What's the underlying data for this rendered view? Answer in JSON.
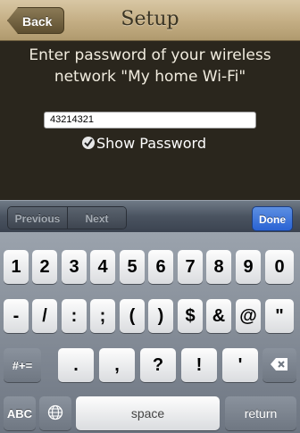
{
  "nav": {
    "back_label": "Back",
    "title": "Setup"
  },
  "prompt": {
    "line1": "Enter password of your wireless",
    "line2": "network \"My home Wi-Fi\""
  },
  "password_field": {
    "value": "43214321"
  },
  "show_password": {
    "label": "Show Password",
    "checked": true
  },
  "toolbar": {
    "previous": "Previous",
    "next": "Next",
    "done": "Done"
  },
  "keyboard": {
    "row1": [
      "1",
      "2",
      "3",
      "4",
      "5",
      "6",
      "7",
      "8",
      "9",
      "0"
    ],
    "row2": [
      "-",
      "/",
      ":",
      ";",
      "(",
      ")",
      "$",
      "&",
      "@",
      "\""
    ],
    "row3": {
      "mode": "#+=",
      "keys": [
        ".",
        ",",
        "?",
        "!",
        "'"
      ],
      "delete_icon": "backspace-icon"
    },
    "row4": {
      "abc": "ABC",
      "globe_icon": "globe-icon",
      "space": "space",
      "return": "return"
    }
  },
  "colors": {
    "accent_blue": "#2a63d4",
    "nav_tan": "#c3ad83",
    "content_bg": "#2a261d"
  }
}
